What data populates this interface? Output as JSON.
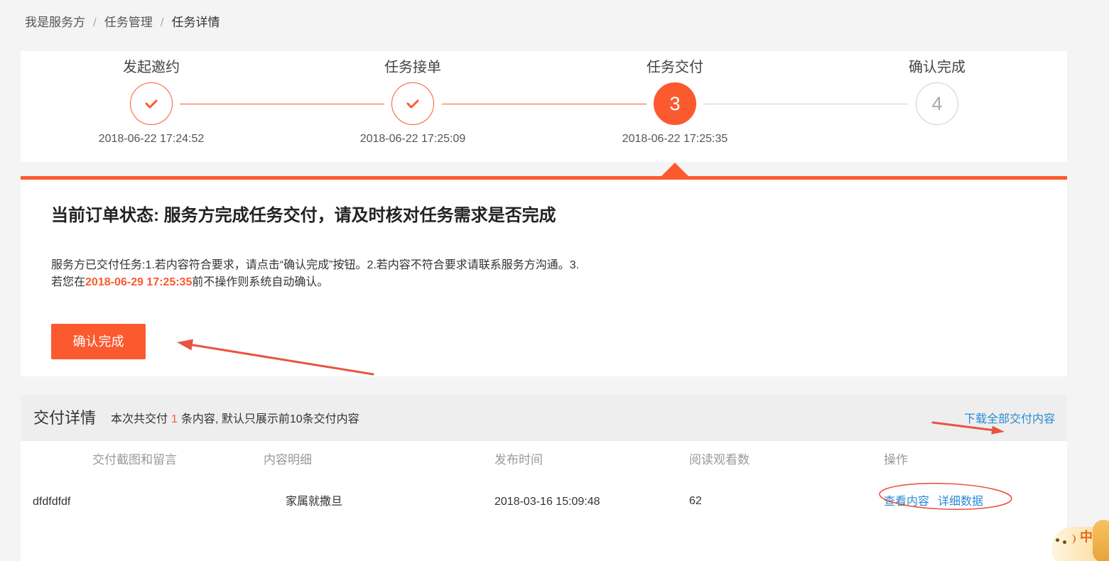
{
  "breadcrumb": {
    "items": [
      "我是服务方",
      "任务管理",
      "任务详情"
    ],
    "separator": "/"
  },
  "steps": [
    {
      "label": "发起邀约",
      "icon": "check-icon",
      "time": "2018-06-22 17:24:52",
      "completed": true,
      "active": false
    },
    {
      "label": "任务接单",
      "icon": "check-icon",
      "time": "2018-06-22 17:25:09",
      "completed": true,
      "active": false
    },
    {
      "label": "任务交付",
      "number": "3",
      "time": "2018-06-22 17:25:35",
      "completed": false,
      "active": true
    },
    {
      "label": "确认完成",
      "number": "4",
      "completed": false,
      "active": false
    }
  ],
  "status": {
    "title": "当前订单状态: 服务方完成任务交付，请及时核对任务需求是否完成",
    "desc_line1": "服务方已交付任务:1.若内容符合要求，请点击“确认完成”按钮。2.若内容不符合要求请联系服务方沟通。3.",
    "desc_prefix": "若您在",
    "deadline": "2018-06-29 17:25:35",
    "desc_suffix": "前不操作则系统自动确认。",
    "confirm_button": "确认完成"
  },
  "delivery": {
    "title": "交付详情",
    "summary_prefix": "本次共交付",
    "count": "1",
    "summary_suffix": "条内容, 默认只展示前10条交付内容",
    "download_link": "下载全部交付内容",
    "columns": [
      "交付截图和留言",
      "内容明细",
      "发布时间",
      "阅读观看数",
      "操作"
    ],
    "rows": [
      {
        "message": "dfdfdfdf",
        "content": "家属就撒旦",
        "time": "2018-03-16 15:09:48",
        "views": "62",
        "actions": [
          "查看内容",
          "详细数据"
        ]
      }
    ]
  },
  "ime": {
    "label": "中"
  },
  "colors": {
    "accent": "#fb5a2f",
    "link": "#2a8ad4",
    "annotation": "#e8553f"
  }
}
